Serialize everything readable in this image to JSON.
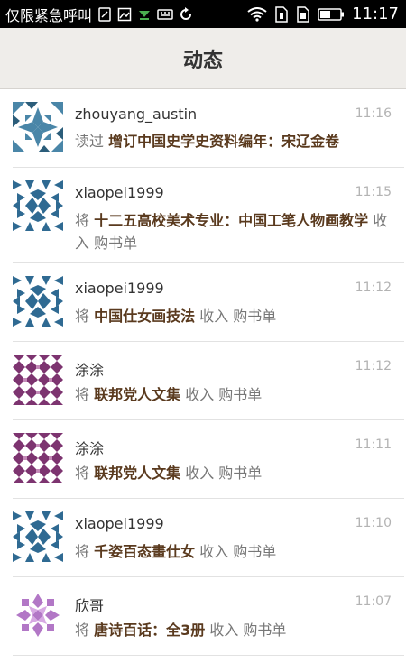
{
  "status_bar": {
    "carrier": "仅限紧急呼叫",
    "time": "11:17",
    "icons": [
      "sim-status-icon",
      "image-notification-icon",
      "download-icon",
      "keyboard-icon",
      "sync-icon",
      "wifi-icon",
      "sim1-icon",
      "sim2-icon",
      "battery-icon"
    ]
  },
  "header": {
    "title": "动态"
  },
  "feed": {
    "items": [
      {
        "user": "zhouyang_austin",
        "time": "11:16",
        "verb": "读过",
        "book": "增订中国史学史资料编年：宋辽金卷",
        "suffix": "",
        "avatar": "blue-quilt"
      },
      {
        "user": "xiaopei1999",
        "time": "11:15",
        "verb": "将",
        "book": "十二五高校美术专业：中国工笔人物画教学",
        "suffix": "收入 购书单",
        "avatar": "navy-quilt"
      },
      {
        "user": "xiaopei1999",
        "time": "11:12",
        "verb": "将",
        "book": "中国仕女画技法",
        "suffix": "收入 购书单",
        "avatar": "navy-quilt"
      },
      {
        "user": "涂涂",
        "time": "11:12",
        "verb": "将",
        "book": "联邦党人文集",
        "suffix": "收入 购书单",
        "avatar": "purple-quilt"
      },
      {
        "user": "涂涂",
        "time": "11:11",
        "verb": "将",
        "book": "联邦党人文集",
        "suffix": "收入 购书单",
        "avatar": "purple-quilt"
      },
      {
        "user": "xiaopei1999",
        "time": "11:10",
        "verb": "将",
        "book": "千姿百态畫仕女",
        "suffix": "收入 购书单",
        "avatar": "navy-quilt"
      },
      {
        "user": "欣哥",
        "time": "11:07",
        "verb": "将",
        "book": "唐诗百话：全3册",
        "suffix": "收入 购书单",
        "avatar": "violet-quilt"
      }
    ]
  },
  "colors": {
    "status_bar_bg": "#000000",
    "header_bg": "#efedea",
    "book_title": "#5a3a1e",
    "meta_text": "#777777",
    "timestamp": "#b3b3b3",
    "avatar_blue": "#3f6f8f",
    "avatar_purple": "#8a3d7a",
    "avatar_violet": "#b073c4"
  }
}
